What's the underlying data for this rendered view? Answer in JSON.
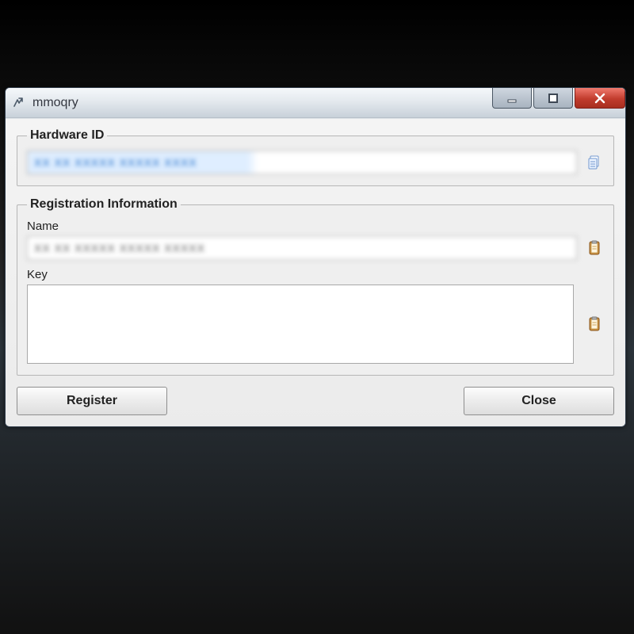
{
  "window": {
    "title": "mmoqry"
  },
  "groups": {
    "hardware_id": {
      "legend": "Hardware ID",
      "value": "XX XX XXXXX XXXXX XXXX"
    },
    "registration": {
      "legend": "Registration Information",
      "name_label": "Name",
      "name_value": "XX XX XXXXX XXXXX XXXXX",
      "key_label": "Key",
      "key_value": ""
    }
  },
  "buttons": {
    "register": "Register",
    "close": "Close"
  }
}
